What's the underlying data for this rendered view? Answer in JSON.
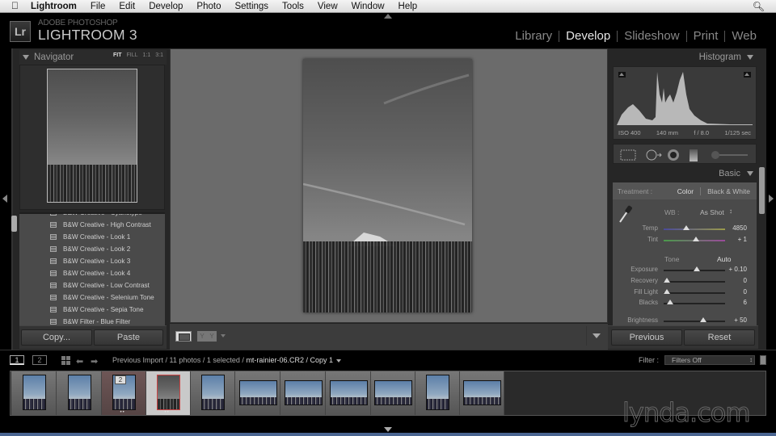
{
  "menubar": {
    "app": "Lightroom",
    "items": [
      "File",
      "Edit",
      "Develop",
      "Photo",
      "Settings",
      "Tools",
      "View",
      "Window",
      "Help"
    ]
  },
  "identity": {
    "logo": "Lr",
    "brand_top": "ADOBE PHOTOSHOP",
    "brand_main": "LIGHTROOM 3"
  },
  "modules": [
    {
      "label": "Library",
      "active": false
    },
    {
      "label": "Develop",
      "active": true
    },
    {
      "label": "Slideshow",
      "active": false
    },
    {
      "label": "Print",
      "active": false
    },
    {
      "label": "Web",
      "active": false
    }
  ],
  "navigator": {
    "title": "Navigator",
    "zoom_options": [
      "FIT",
      "FILL",
      "1:1",
      "3:1"
    ],
    "zoom_selected": "FIT"
  },
  "presets": [
    "B&W Creative - Cyanotype",
    "B&W Creative - High Contrast",
    "B&W Creative - Look 1",
    "B&W Creative - Look 2",
    "B&W Creative - Look 3",
    "B&W Creative - Look 4",
    "B&W Creative - Low Contrast",
    "B&W Creative - Selenium Tone",
    "B&W Creative - Sepia Tone",
    "B&W Filter - Blue Filter"
  ],
  "left_buttons": {
    "copy": "Copy...",
    "paste": "Paste"
  },
  "histogram": {
    "title": "Histogram",
    "iso": "ISO 400",
    "focal": "140 mm",
    "aperture": "f / 8.0",
    "shutter": "1/125 sec"
  },
  "basic": {
    "title": "Basic",
    "treatment_label": "Treatment :",
    "treatment_color": "Color",
    "treatment_bw": "Black & White",
    "wb_label": "WB :",
    "wb_value": "As Shot",
    "tone_label": "Tone",
    "auto_label": "Auto",
    "sliders": [
      {
        "label": "Temp",
        "value": "4850",
        "position": 0.33,
        "track": "temp"
      },
      {
        "label": "Tint",
        "value": "+ 1",
        "position": 0.5,
        "track": "tint"
      },
      {
        "label": "Exposure",
        "value": "+ 0.10",
        "position": 0.51,
        "track": "plain"
      },
      {
        "label": "Recovery",
        "value": "0",
        "position": 0.0,
        "track": "plain"
      },
      {
        "label": "Fill Light",
        "value": "0",
        "position": 0.0,
        "track": "plain"
      },
      {
        "label": "Blacks",
        "value": "6",
        "position": 0.06,
        "track": "plain"
      },
      {
        "label": "Brightness",
        "value": "+ 50",
        "position": 0.63,
        "track": "plain"
      }
    ]
  },
  "right_buttons": {
    "previous": "Previous",
    "reset": "Reset"
  },
  "filmstrip_bar": {
    "screen1": "1",
    "screen2": "2",
    "source_prefix": "Previous Import / 11 photos / 1 selected /",
    "source_file": "mt-rainier-06.CR2 / Copy 1",
    "filter_label": "Filter :",
    "filter_value": "Filters Off"
  },
  "filmstrip": [
    {
      "orientation": "p",
      "tone": "color",
      "state": ""
    },
    {
      "orientation": "p",
      "tone": "color",
      "state": ""
    },
    {
      "orientation": "p",
      "tone": "color",
      "state": "sel1",
      "badge": "2",
      "stars": "••"
    },
    {
      "orientation": "p",
      "tone": "bw",
      "state": "sel0",
      "stars": "••"
    },
    {
      "orientation": "p",
      "tone": "color",
      "state": ""
    },
    {
      "orientation": "l",
      "tone": "color",
      "state": ""
    },
    {
      "orientation": "l",
      "tone": "color",
      "state": ""
    },
    {
      "orientation": "l",
      "tone": "color",
      "state": ""
    },
    {
      "orientation": "l",
      "tone": "color",
      "state": ""
    },
    {
      "orientation": "p",
      "tone": "color",
      "state": ""
    },
    {
      "orientation": "l",
      "tone": "color",
      "state": ""
    }
  ],
  "watermark": "lynda.com"
}
